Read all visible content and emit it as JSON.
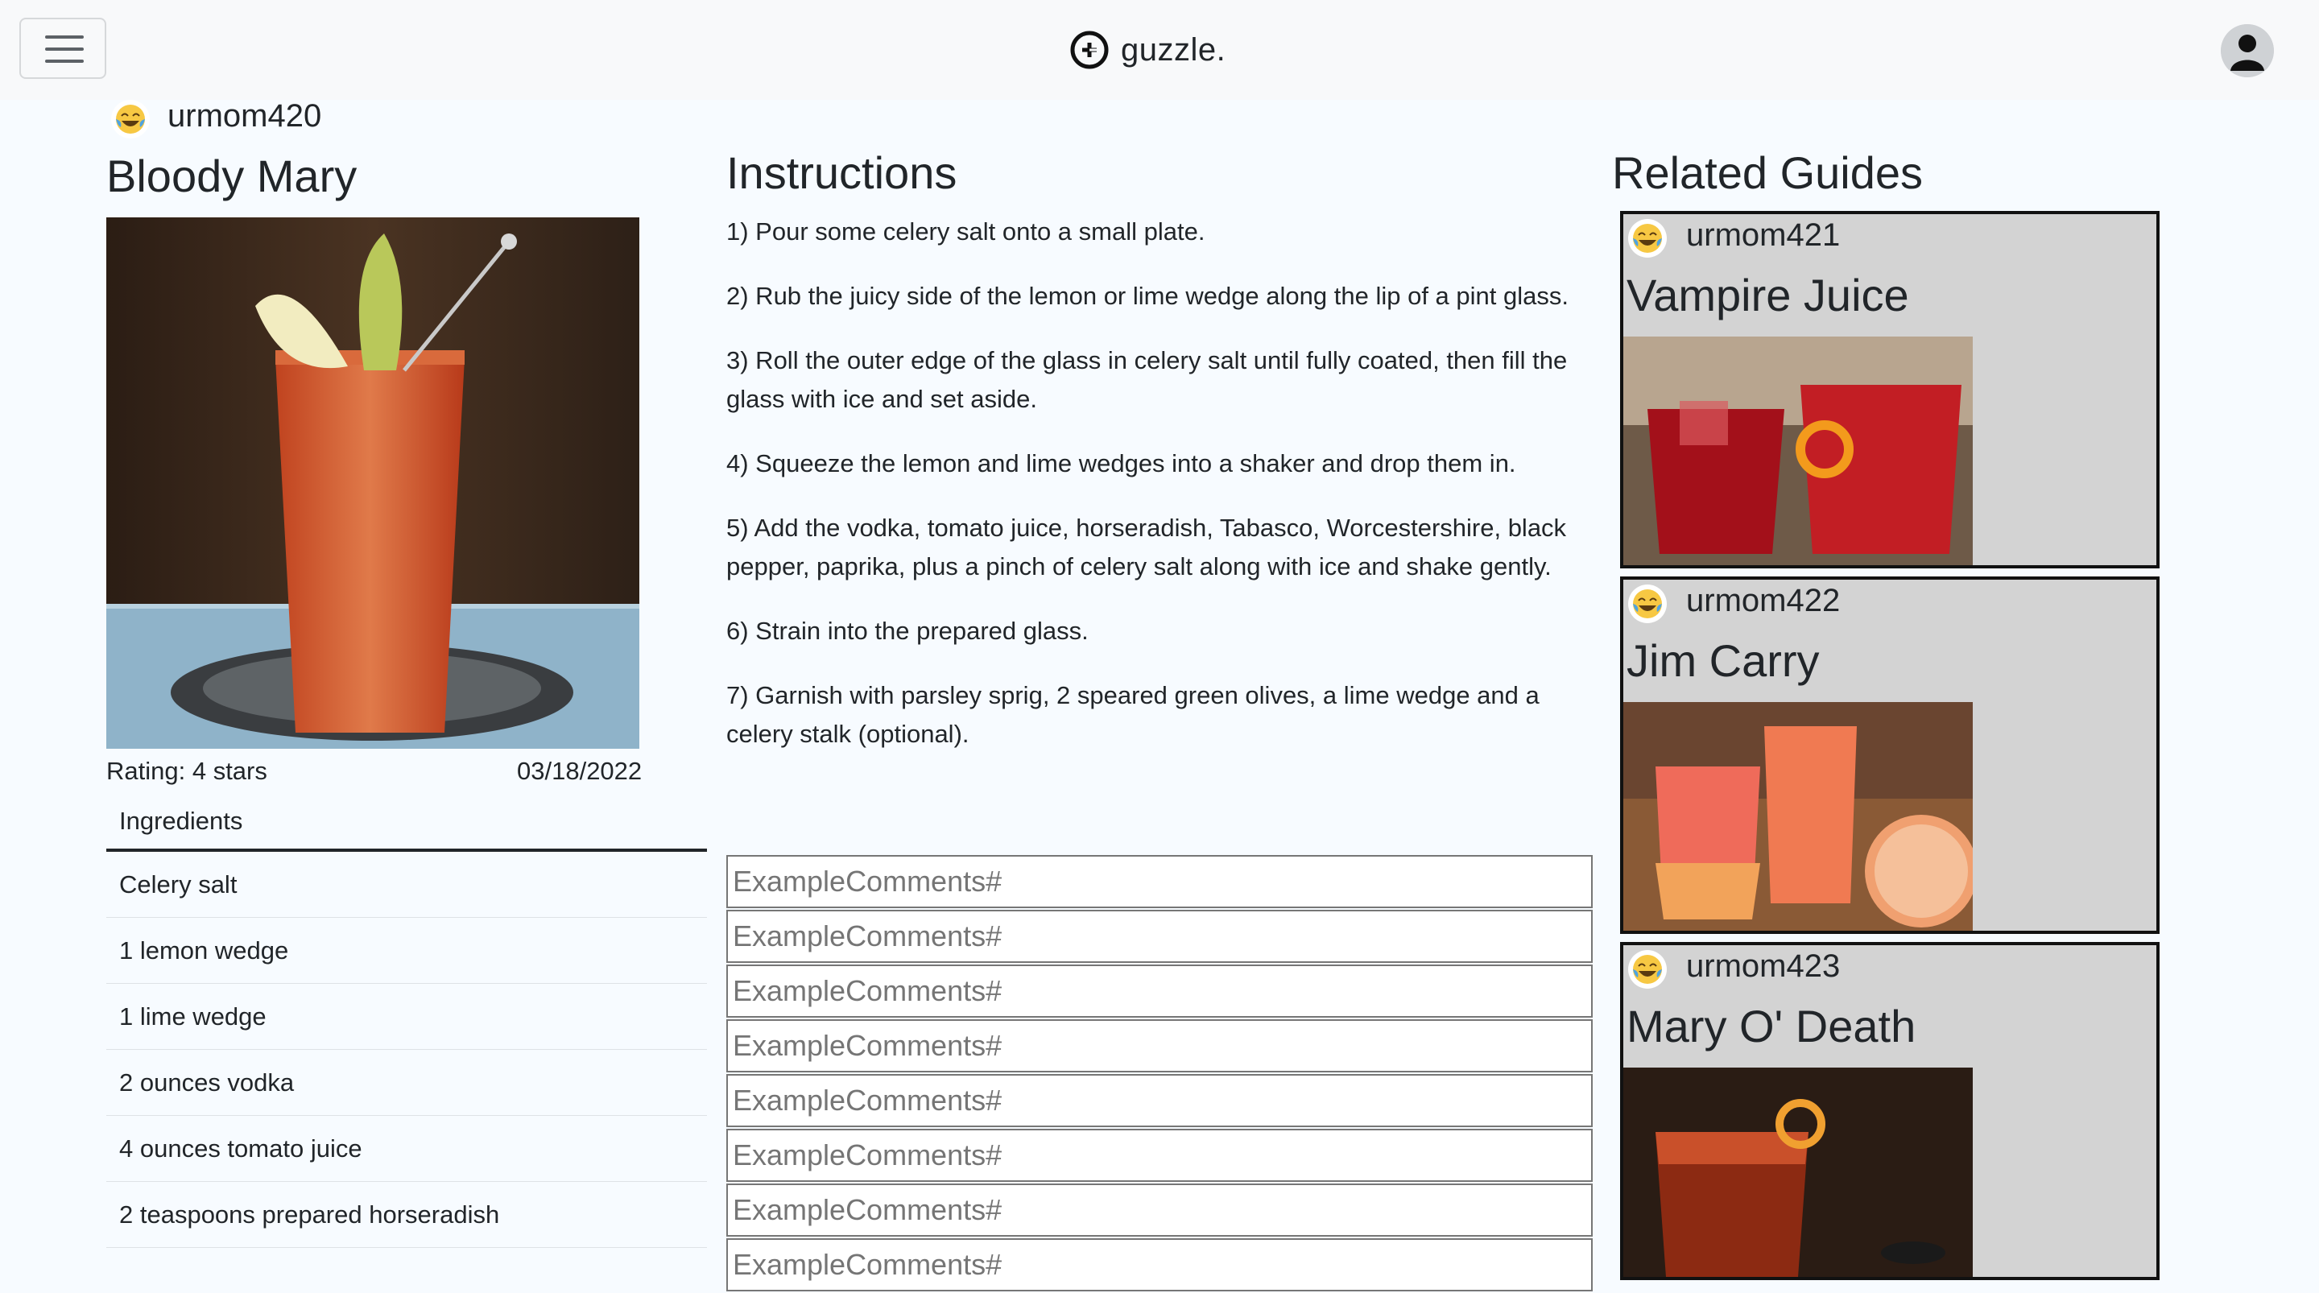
{
  "navbar": {
    "menu_icon": "hamburger-menu-icon",
    "brand_name": "guzzle.",
    "brand_icon": "guzzle-logo-icon",
    "profile_icon": "user-avatar-icon"
  },
  "recipe": {
    "author": "urmom420",
    "author_icon": "laughing-tears-emoji-icon",
    "title": "Bloody Mary",
    "rating": "Rating: 4 stars",
    "date": "03/18/2022",
    "ingredients_header": "Ingredients",
    "ingredients": [
      "Celery salt",
      "1 lemon wedge",
      "1 lime wedge",
      "2 ounces vodka",
      "4 ounces tomato juice",
      "2 teaspoons prepared horseradish"
    ]
  },
  "instructions": {
    "title": "Instructions",
    "steps": [
      "1) Pour some celery salt onto a small plate.",
      "2) Rub the juicy side of the lemon or lime wedge along the lip of a pint glass.",
      "3) Roll the outer edge of the glass in celery salt until fully coated, then fill the glass with ice and set aside.",
      "4) Squeeze the lemon and lime wedges into a shaker and drop them in.",
      "5) Add the vodka, tomato juice, horseradish, Tabasco, Worcestershire, black pepper, paprika, plus a pinch of celery salt along with ice and shake gently.",
      "6) Strain into the prepared glass.",
      "7) Garnish with parsley sprig, 2 speared green olives, a lime wedge and a celery stalk (optional)."
    ]
  },
  "comments": {
    "placeholder": "ExampleComments#",
    "count_visible": 8
  },
  "related": {
    "title": "Related Guides",
    "guides": [
      {
        "author": "urmom421",
        "title": "Vampire Juice"
      },
      {
        "author": "urmom422",
        "title": "Jim Carry"
      },
      {
        "author": "urmom423",
        "title": "Mary O' Death"
      }
    ]
  }
}
